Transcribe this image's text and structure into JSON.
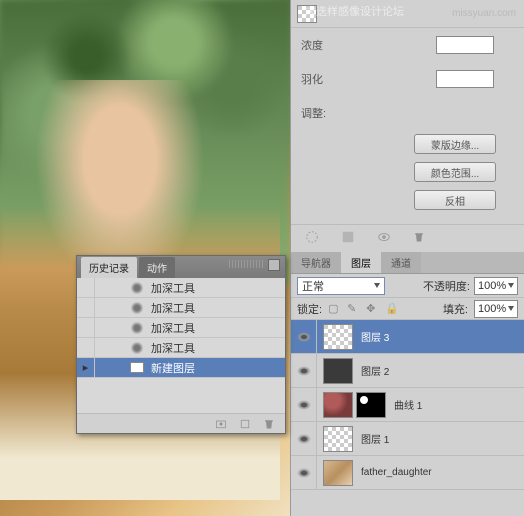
{
  "watermark1": "末迭样感像设计论坛",
  "watermark2": "missyuan.com",
  "maskPanel": {
    "density": "浓度",
    "feather": "羽化",
    "adjust": "调整:",
    "maskEdge": "蒙版边缘...",
    "colorRange": "颜色范围...",
    "invert": "反相"
  },
  "history": {
    "tab1": "历史记录",
    "tab2": "动作",
    "items": [
      "加深工具",
      "加深工具",
      "加深工具",
      "加深工具",
      "新建图层"
    ]
  },
  "layersPanel": {
    "tabNav": "导航器",
    "tabLayers": "图层",
    "tabChannels": "通道",
    "blendMode": "正常",
    "opacityLabel": "不透明度:",
    "opacityVal": "100%",
    "lockLabel": "锁定:",
    "fillLabel": "填充:",
    "fillVal": "100%",
    "layers": [
      {
        "name": "图层 3"
      },
      {
        "name": "图层 2"
      },
      {
        "name": "曲线 1"
      },
      {
        "name": "图层 1"
      },
      {
        "name": "father_daughter"
      }
    ]
  }
}
